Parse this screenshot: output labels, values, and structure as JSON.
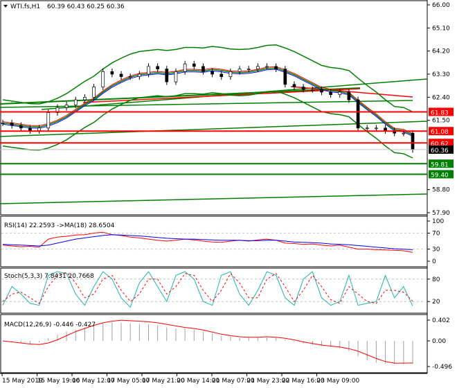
{
  "header": {
    "symbol": "WTI.fs,H1",
    "ohlc": "60.39 60.43 60.25 60.36"
  },
  "colors": {
    "bull": "#008000",
    "red": "#ff0000",
    "green": "#008000",
    "blue": "#0000ff",
    "teal": "#20b2aa",
    "current": "#000000"
  },
  "chart_data": [
    {
      "type": "line",
      "title": "WTI.fs,H1",
      "ylim": [
        57.9,
        66.0
      ],
      "yticks": [
        "66.00",
        "65.10",
        "64.20",
        "63.30",
        "62.40",
        "61.50",
        "58.80",
        "57.90"
      ],
      "xticks": [
        "15 May 2019",
        "15 May 19:00",
        "16 May 12:00",
        "17 May 05:00",
        "17 May 21:00",
        "20 May 14:00",
        "21 May 07:00",
        "21 May 23:00",
        "22 May 16:00",
        "23 May 09:00"
      ],
      "close": [
        61.4,
        61.3,
        61.2,
        61.1,
        61.2,
        61.8,
        62.0,
        62.1,
        62.3,
        62.4,
        62.8,
        63.4,
        63.3,
        63.2,
        63.2,
        63.3,
        63.6,
        63.5,
        63.0,
        63.4,
        63.7,
        63.6,
        63.4,
        63.3,
        63.2,
        63.4,
        63.5,
        63.5,
        63.6,
        63.6,
        63.5,
        62.9,
        62.8,
        62.7,
        62.7,
        62.6,
        62.5,
        62.6,
        62.3,
        61.2,
        61.2,
        61.2,
        61.1,
        61.0,
        61.0,
        60.36
      ],
      "levels": [
        {
          "value": 61.83,
          "label": "61.83",
          "color": "red"
        },
        {
          "value": 61.08,
          "label": "61.08",
          "color": "red"
        },
        {
          "value": 60.62,
          "label": "60.62",
          "color": "red"
        },
        {
          "value": 59.81,
          "label": "59.81",
          "color": "green"
        },
        {
          "value": 59.4,
          "label": "59.40",
          "color": "green"
        }
      ],
      "current": {
        "value": 60.36,
        "label": "60.36"
      }
    },
    {
      "type": "line",
      "title": "RSI(14) 22.2593 ->MA(18) 28.6504",
      "ylim": [
        0,
        100
      ],
      "yticks": [
        "100",
        "70",
        "30",
        "0"
      ],
      "rsi": [
        40,
        38,
        36,
        37,
        35,
        55,
        60,
        62,
        65,
        66,
        70,
        72,
        66,
        64,
        60,
        58,
        55,
        52,
        50,
        52,
        55,
        53,
        50,
        48,
        47,
        50,
        52,
        50,
        53,
        55,
        52,
        45,
        44,
        42,
        43,
        40,
        38,
        40,
        35,
        30,
        30,
        29,
        28,
        27,
        26,
        22
      ],
      "ma": [
        42,
        41,
        40,
        39,
        38,
        40,
        45,
        50,
        55,
        58,
        61,
        64,
        66,
        65,
        64,
        63,
        61,
        59,
        57,
        56,
        55,
        55,
        54,
        53,
        52,
        52,
        52,
        51,
        51,
        52,
        52,
        50,
        48,
        47,
        46,
        45,
        43,
        42,
        41,
        39,
        37,
        35,
        33,
        31,
        30,
        28.7
      ]
    },
    {
      "type": "line",
      "title": "Stoch(5,3,3) 7.8431 20.7668",
      "ylim": [
        0,
        100
      ],
      "yticks": [
        "80",
        "20"
      ],
      "k": [
        10,
        60,
        40,
        15,
        10,
        90,
        100,
        95,
        40,
        10,
        60,
        100,
        80,
        30,
        5,
        70,
        100,
        60,
        20,
        90,
        100,
        80,
        20,
        10,
        90,
        100,
        40,
        10,
        50,
        100,
        90,
        30,
        10,
        80,
        100,
        30,
        10,
        20,
        90,
        10,
        15,
        20,
        90,
        30,
        60,
        8
      ],
      "d": [
        20,
        40,
        45,
        30,
        15,
        60,
        90,
        98,
        70,
        30,
        40,
        80,
        90,
        50,
        20,
        40,
        80,
        80,
        40,
        60,
        95,
        90,
        50,
        20,
        50,
        95,
        70,
        30,
        30,
        80,
        95,
        60,
        20,
        50,
        90,
        60,
        25,
        15,
        60,
        40,
        20,
        15,
        50,
        50,
        45,
        21
      ]
    },
    {
      "type": "line",
      "title": "MACD(12,26,9) -0.446 -0.427",
      "ylim": [
        -0.496,
        0.402
      ],
      "yticks": [
        "0.402",
        "0.00",
        "-0.496"
      ],
      "hist": [
        0.0,
        -0.02,
        -0.05,
        -0.06,
        -0.03,
        0.05,
        0.12,
        0.18,
        0.22,
        0.26,
        0.3,
        0.34,
        0.36,
        0.35,
        0.34,
        0.33,
        0.32,
        0.3,
        0.26,
        0.24,
        0.24,
        0.22,
        0.18,
        0.14,
        0.1,
        0.08,
        0.06,
        0.06,
        0.06,
        0.06,
        0.06,
        0.02,
        -0.02,
        -0.05,
        -0.08,
        -0.1,
        -0.12,
        -0.14,
        -0.2,
        -0.3,
        -0.38,
        -0.42,
        -0.44,
        -0.45,
        -0.45,
        -0.446
      ],
      "signal": [
        0.0,
        -0.02,
        -0.04,
        -0.06,
        -0.07,
        -0.04,
        0.02,
        0.1,
        0.18,
        0.24,
        0.3,
        0.35,
        0.38,
        0.4,
        0.39,
        0.38,
        0.37,
        0.35,
        0.32,
        0.29,
        0.26,
        0.24,
        0.21,
        0.17,
        0.13,
        0.1,
        0.08,
        0.07,
        0.07,
        0.08,
        0.07,
        0.05,
        0.02,
        -0.02,
        -0.05,
        -0.08,
        -0.1,
        -0.12,
        -0.15,
        -0.2,
        -0.27,
        -0.34,
        -0.4,
        -0.43,
        -0.43,
        -0.427
      ]
    }
  ]
}
